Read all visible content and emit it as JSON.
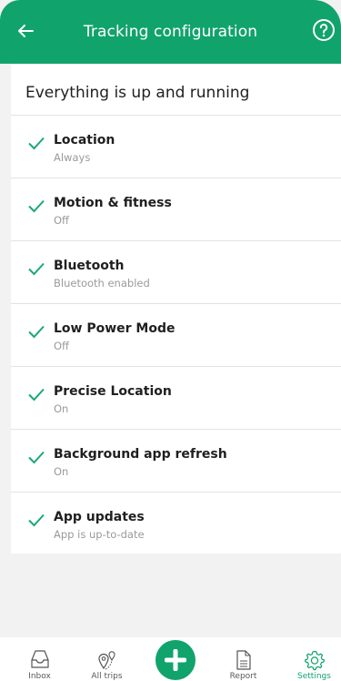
{
  "header": {
    "title": "Tracking configuration"
  },
  "card": {
    "title": "Everything is up and running",
    "items": [
      {
        "name": "Location",
        "status": "Always"
      },
      {
        "name": "Motion & fitness",
        "status": "Off"
      },
      {
        "name": "Bluetooth",
        "status": "Bluetooth enabled"
      },
      {
        "name": "Low Power Mode",
        "status": "Off"
      },
      {
        "name": "Precise Location",
        "status": "On"
      },
      {
        "name": "Background app refresh",
        "status": "On"
      },
      {
        "name": "App updates",
        "status": "App is up-to-date"
      }
    ]
  },
  "tabbar": {
    "tabs": [
      {
        "label": "Inbox",
        "icon": "inbox-icon"
      },
      {
        "label": "All trips",
        "icon": "map-pins-icon"
      },
      {
        "label": "Report",
        "icon": "document-icon"
      },
      {
        "label": "Settings",
        "icon": "gear-icon"
      }
    ],
    "fab_icon": "plus-icon"
  },
  "colors": {
    "accent": "#11a36c",
    "check": "#19a974",
    "background": "#f2f2f2"
  }
}
